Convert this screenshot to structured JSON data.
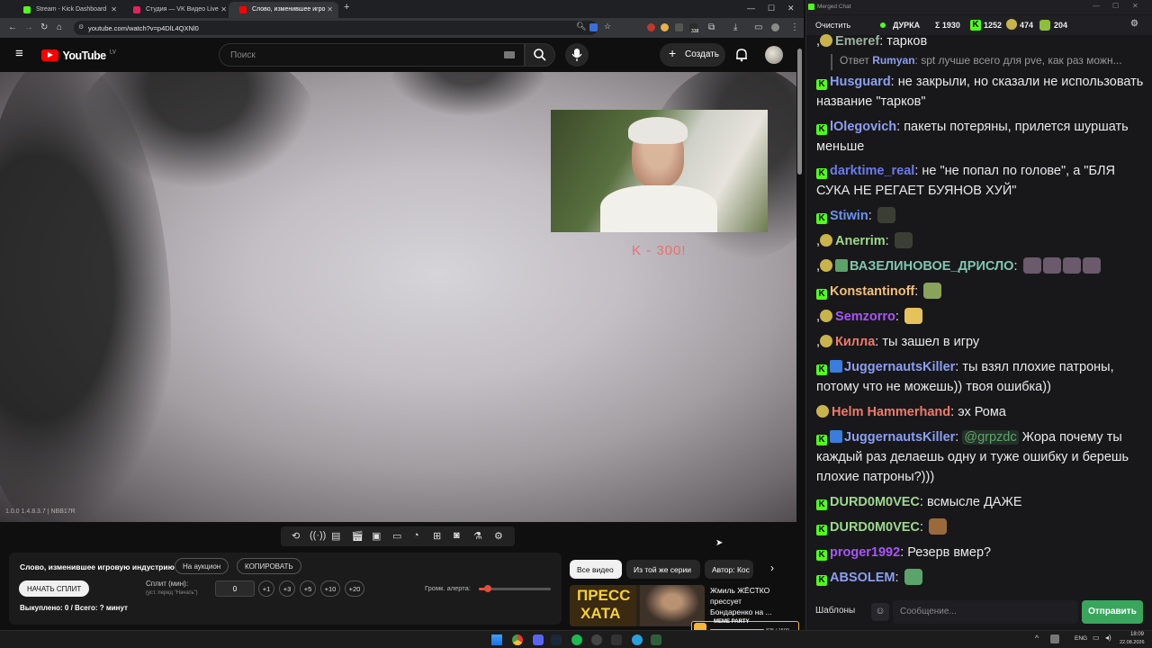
{
  "browser": {
    "tabs": [
      {
        "label": "Stream - Kick Dashboard",
        "color": "#53fc18"
      },
      {
        "label": "Студия — VK Видео Live",
        "color": "#e0245e"
      },
      {
        "label": "Слово, изменившее игро",
        "color": "#ff0000"
      }
    ],
    "url": "youtube.com/watch?v=p4DlL4QXNl0",
    "new_tab": "+",
    "ext_badge": "338"
  },
  "youtube": {
    "logo_text": "YouTube",
    "region": "LV",
    "search_placeholder": "Поиск",
    "create_label": "Создать"
  },
  "video": {
    "overlay_text": "K - 300!",
    "stats_text": "1.0.0 1.4.8.3.7 | NBB17R"
  },
  "panel": {
    "title": "Слово, изменившее игровую индустрию",
    "auction_btn": "На аукцион",
    "copy_btn": "КОПИРОВАТЬ",
    "start_split_btn": "НАЧАТЬ СПЛИТ",
    "split_label": "Сплит (мин):",
    "split_hint": "(уст. перед \"Начать\")",
    "split_value": "0",
    "steps": [
      "+1",
      "+3",
      "+5",
      "+10",
      "+20"
    ],
    "alert_volume_label": "Громк. алерта:",
    "alert_volume_level": 0.12,
    "paid_text": "Выкуплено: 0 / Всего: ? минут"
  },
  "related": {
    "chips": [
      "Все видео",
      "Из той же серии",
      "Автор: Кос"
    ],
    "video_title": "Жмиль ЖЁСТКО прессует Бондаренко на ...",
    "thumb_text_1": "ПРЕСС",
    "thumb_text_2": "ХАТА",
    "widget_label": "MEME PARTY",
    "widget_count": "825 / 1500"
  },
  "chat": {
    "window_title": "Merged Chat",
    "clear_btn": "Очистить",
    "status_name": "ДУРКА",
    "stat_total": "Σ 1930",
    "stat_kick": "1252",
    "stat_twitch": "474",
    "stat_vk": "204",
    "templates_btn": "Шаблоны",
    "input_placeholder": "Сообщение...",
    "send_btn": "Отправить",
    "messages": [
      {
        "user": "Emeref",
        "text": "тарков",
        "color": "#9bb2a0"
      },
      {
        "reply_prefix": "Ответ",
        "reply_user": "Rumyan",
        "reply_text": "spt лучше всего для pve, как раз можн..."
      },
      {
        "user": "Husguard",
        "text": "не закрыли, но сказали не использовать название \"тарков\"",
        "color": "#8c9ff0"
      },
      {
        "user": "lOlegovich",
        "text": "пакеты потеряны, прилется шуршать меньше",
        "color": "#8c9ff0"
      },
      {
        "user": "darktime_real",
        "text": "не \"не попал по голове\", а \"БЛЯ СУКА НЕ РЕГАЕТ БУЯНОВ ХУЙ\"",
        "color": "#6a7bea"
      },
      {
        "user": "Stiwin",
        "text": "",
        "color": "#6a92ea"
      },
      {
        "user": "Anerrim",
        "text": "",
        "color": "#9fd88d"
      },
      {
        "user": "ВАЗЕЛИНОВОЕ_ДРИСЛО",
        "text": "",
        "color": "#7ec7b0"
      },
      {
        "user": "Konstantinoff",
        "text": "",
        "color": "#f0c07a"
      },
      {
        "user": "Semzorro",
        "text": "",
        "color": "#a855f7"
      },
      {
        "user": "Килла",
        "text": "ты зашел в игру",
        "color": "#f07a6a"
      },
      {
        "user": "JuggernautsKiller",
        "text": "ты взял плохие патроны, потому что не можешь)) твоя ошибка))",
        "color": "#8c9ff0"
      },
      {
        "user": "Helm Hammerhand",
        "text": "эх Рома",
        "color": "#f07a6a"
      },
      {
        "user": "JuggernautsKiller",
        "mention": "@grpzdc",
        "text": "Жора почему ты каждый раз делаешь одну и туже ошибку и берешь плохие патроны?)))",
        "color": "#8c9ff0"
      },
      {
        "user": "DURD0M0VEC",
        "text": "всмысле ДАЖЕ",
        "color": "#9fd88d"
      },
      {
        "user": "DURD0M0VEC",
        "text": "",
        "color": "#9fd88d"
      },
      {
        "user": "proger1992",
        "text": "Резерв  вмер?",
        "color": "#a855f7"
      },
      {
        "user": "ABSOLEM",
        "text": "",
        "color": "#8c9ff0"
      }
    ]
  },
  "taskbar": {
    "lang": "ENG",
    "time": "18:09",
    "date": "22.08.2026"
  }
}
